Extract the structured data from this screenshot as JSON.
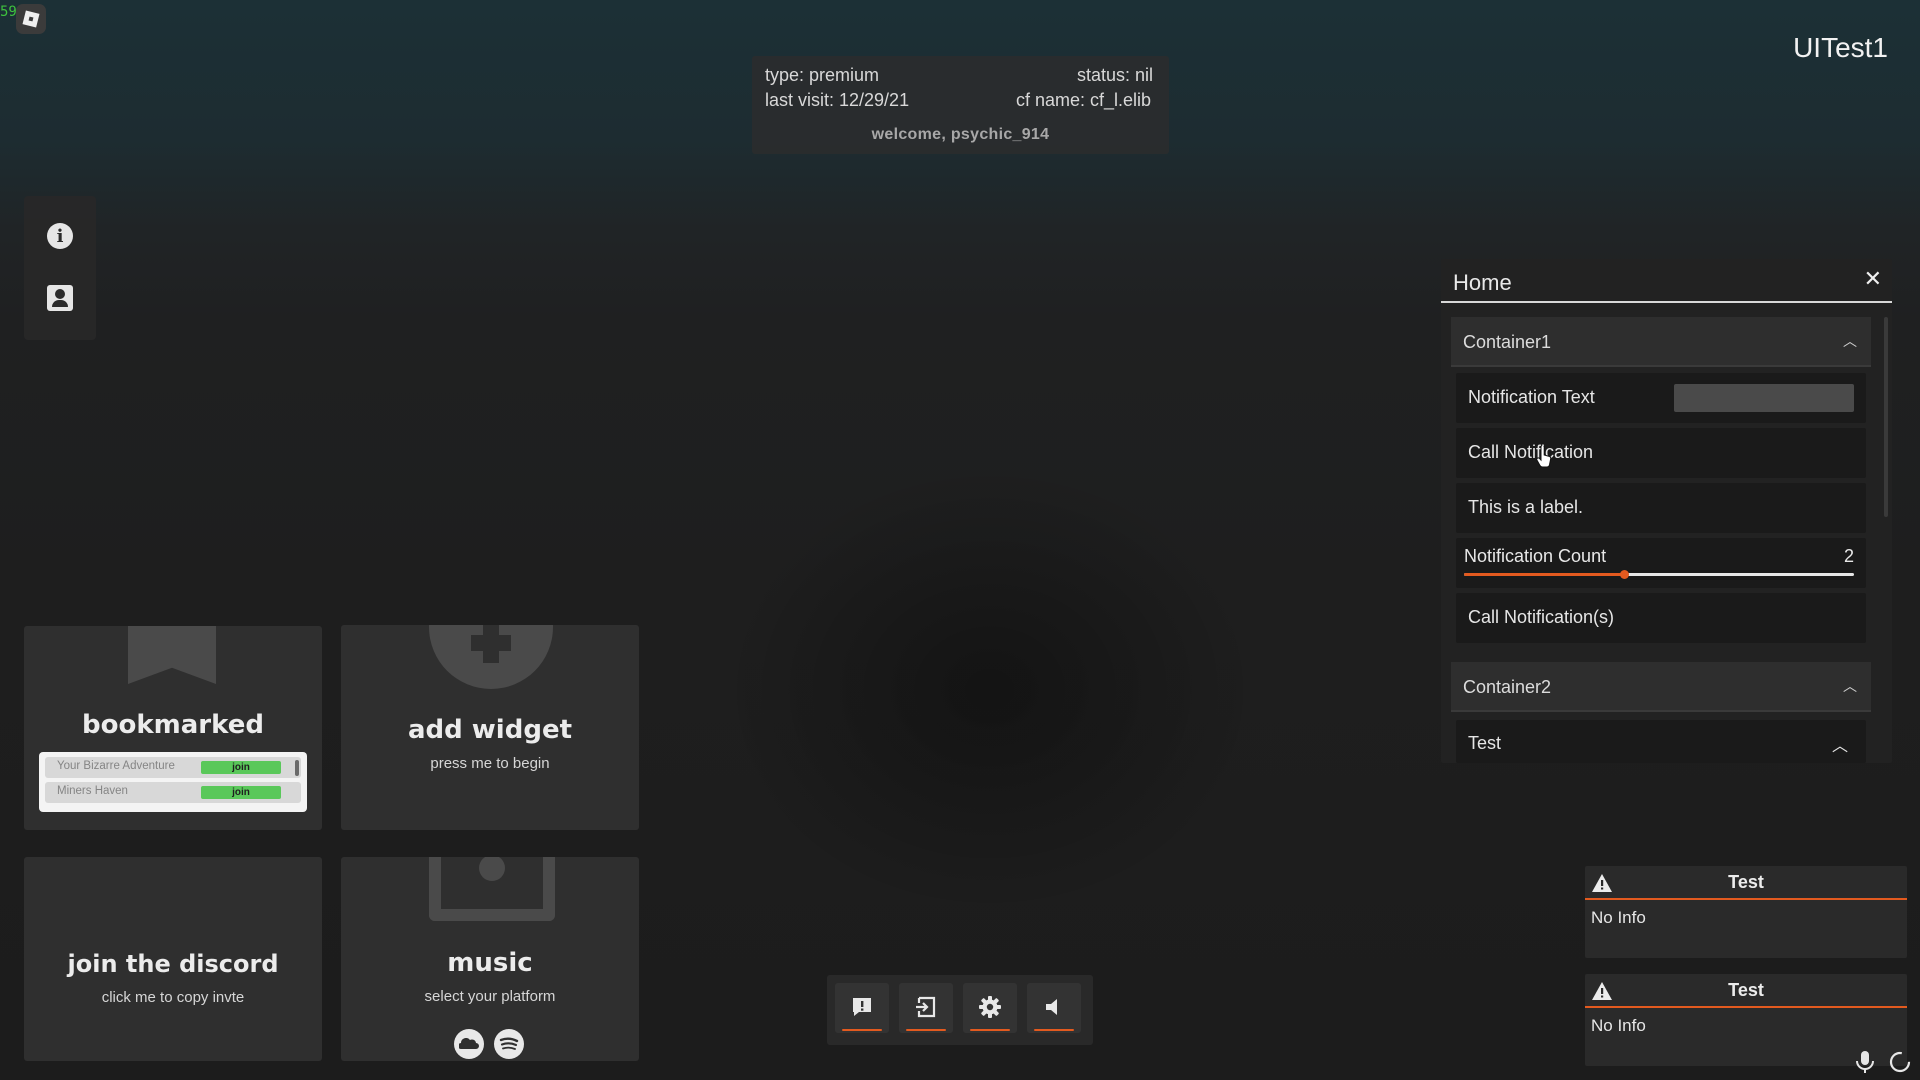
{
  "top_left": {
    "fps": "59",
    "roblox_icon": "roblox-logo-icon"
  },
  "window_title": "UITest1",
  "info_panel": {
    "type": "type: premium",
    "status": "status: nil",
    "last_visit": "last visit: 12/29/21",
    "cf_name": "cf name: cf_l.elib",
    "welcome": "welcome, psychic_914"
  },
  "side_bar": {
    "icons": [
      "info-icon",
      "profile-icon"
    ]
  },
  "widgets": {
    "bookmarked": {
      "title": "bookmarked",
      "items": [
        {
          "name": "Your Bizarre Adventure",
          "action": "join"
        },
        {
          "name": "Miners Haven",
          "action": "join"
        }
      ]
    },
    "add_widget": {
      "title": "add widget",
      "subtitle": "press me to begin"
    },
    "discord": {
      "title": "join the discord",
      "subtitle": "click me to copy invte"
    },
    "music": {
      "title": "music",
      "subtitle": "select your platform",
      "platforms": [
        "soundcloud-icon",
        "spotify-icon"
      ]
    }
  },
  "toolbar": {
    "buttons": [
      "report-icon",
      "exit-icon",
      "settings-icon",
      "volume-icon"
    ]
  },
  "home_window": {
    "title": "Home",
    "container1": {
      "label": "Container1",
      "notification_text_label": "Notification Text",
      "notification_text_value": "",
      "call_notification": "Call Notification",
      "label_text": "This is a label.",
      "slider": {
        "label": "Notification Count",
        "value": "2",
        "fraction": 0.41
      },
      "call_notifications": "Call Notification(s)"
    },
    "container2": {
      "label": "Container2",
      "test_dropdown": "Test"
    }
  },
  "notifications": [
    {
      "title": "Test",
      "body": "No Info"
    },
    {
      "title": "Test",
      "body": "No Info"
    }
  ],
  "colors": {
    "accent": "#e35a1f",
    "join_green": "#5ac85a",
    "fps_green": "#3ec13e"
  }
}
